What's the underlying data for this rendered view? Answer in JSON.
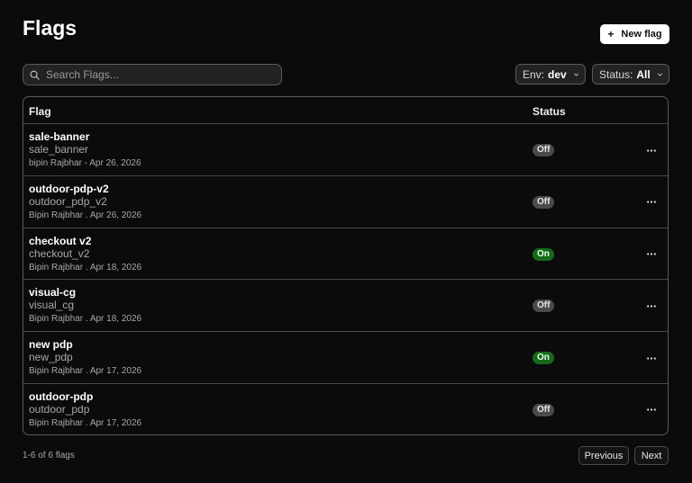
{
  "header": {
    "title": "Flags",
    "new_flag_label": "New flag"
  },
  "search": {
    "placeholder": "Search Flags...",
    "value": ""
  },
  "filters": {
    "env_label": "Env:",
    "env_value": "dev",
    "status_label": "Status:",
    "status_value": "All"
  },
  "table": {
    "columns": {
      "flag": "Flag",
      "status": "Status"
    },
    "rows": [
      {
        "name": "sale-banner",
        "key": "sale_banner",
        "meta": "bipin Rajbhar - Apr 26, 2026",
        "status": "Off"
      },
      {
        "name": "outdoor-pdp-v2",
        "key": "outdoor_pdp_v2",
        "meta": "Bipin Rajbhar . Apr 26, 2026",
        "status": "Off"
      },
      {
        "name": "checkout v2",
        "key": "checkout_v2",
        "meta": "Bipin Rajbhar . Apr 18, 2026",
        "status": "On"
      },
      {
        "name": "visual-cg",
        "key": "visual_cg",
        "meta": "Bipin Rajbhar . Apr 18, 2026",
        "status": "Off"
      },
      {
        "name": "new pdp",
        "key": "new_pdp",
        "meta": "Bipin Rajbhar . Apr 17, 2026",
        "status": "On"
      },
      {
        "name": "outdoor-pdp",
        "key": "outdoor_pdp",
        "meta": "Bipin Rajbhar . Apr 17, 2026",
        "status": "Off"
      }
    ]
  },
  "footer": {
    "count": "1-6 of 6 flags",
    "previous_label": "Previous",
    "next_label": "Next"
  },
  "colors": {
    "background": "#0b0b0b",
    "badge_on": "#166a1a",
    "badge_off": "#4a4a4a"
  },
  "icons": {
    "new_flag": "plus-icon",
    "search": "search-icon",
    "dropdown": "chevron-down-icon",
    "row_menu": "more-horizontal-icon"
  }
}
